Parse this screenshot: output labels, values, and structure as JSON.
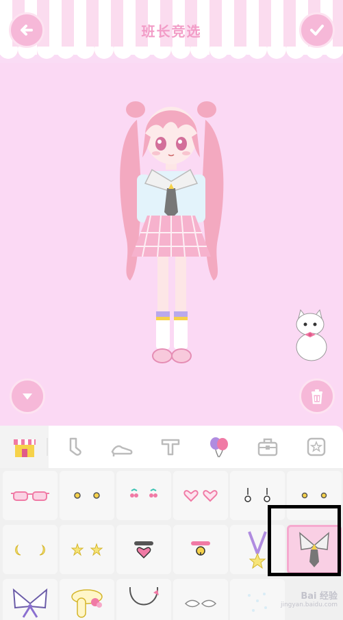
{
  "header": {
    "title": "班长竞选",
    "back_icon": "arrow-left-icon",
    "confirm_icon": "checkmark-icon"
  },
  "stage": {
    "collapse_icon": "chevron-down-icon",
    "delete_icon": "trash-icon"
  },
  "categories": [
    {
      "name": "shop-icon",
      "active": true
    },
    {
      "name": "sock-icon",
      "active": false
    },
    {
      "name": "shoe-icon",
      "active": false
    },
    {
      "name": "text-t-icon",
      "active": false
    },
    {
      "name": "balloon-icon",
      "active": false
    },
    {
      "name": "bag-icon",
      "active": false
    },
    {
      "name": "star-icon",
      "active": false
    }
  ],
  "items": [
    {
      "name": "pink-glasses-icon"
    },
    {
      "name": "gold-dot-earrings-icon"
    },
    {
      "name": "cherry-earrings-icon"
    },
    {
      "name": "heart-earrings-icon"
    },
    {
      "name": "drop-earrings-icon"
    },
    {
      "name": "small-gold-earrings-icon"
    },
    {
      "name": "moon-earrings-icon"
    },
    {
      "name": "star-earrings-icon"
    },
    {
      "name": "heart-choker-icon"
    },
    {
      "name": "bell-choker-icon"
    },
    {
      "name": "star-necklace-icon"
    },
    {
      "name": "sailor-tie-collar-icon",
      "selected": true
    },
    {
      "name": "sailor-bow-collar-icon"
    },
    {
      "name": "fluffy-scarf-icon"
    },
    {
      "name": "pearl-necklace-icon"
    },
    {
      "name": "wing-necklace-icon"
    },
    {
      "name": "sparkle-accessory-icon"
    }
  ],
  "watermark": {
    "text": "Bai 经验",
    "sub": "jingyan.baidu.com"
  },
  "colors": {
    "background": "#fadcf5",
    "accent_pink": "#f6b8d8",
    "title_pink": "#f29cc7",
    "highlight_box": "#000000"
  }
}
